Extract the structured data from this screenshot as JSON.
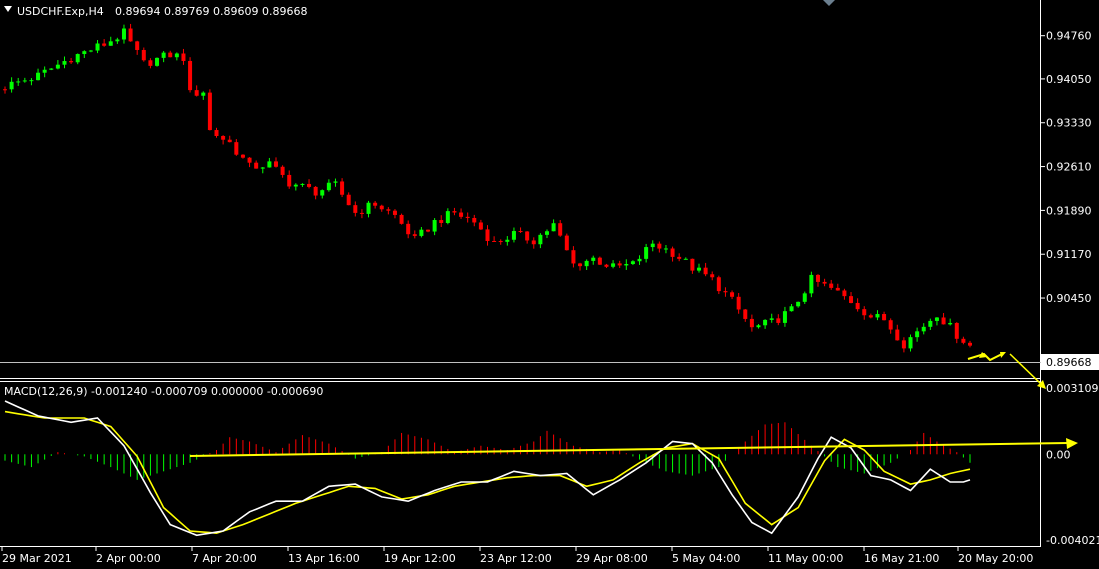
{
  "header": {
    "symbol": "USDCHF.Exp,H4",
    "ohlc": "0.89694 0.89769 0.89609 0.89668"
  },
  "macd_header": "MACD(12,26,9) -0.001240 -0.000709 0.000000 -0.000690",
  "current_price_label": "0.89668",
  "colors": {
    "background": "#000000",
    "bull": "#00ff00",
    "bear": "#ff0000",
    "macd_main": "#ffffff",
    "macd_signal": "#ffff00",
    "arrow": "#ffff00",
    "grid_line": "#ffffff"
  },
  "chart_data": [
    {
      "type": "candlestick",
      "timeframe": "H4",
      "ylim": [
        0.8935,
        0.951
      ],
      "y_ticks": [
        "0.94760",
        "0.94050",
        "0.93330",
        "0.92610",
        "0.91890",
        "0.91170",
        "0.90450"
      ],
      "x_ticks": [
        "29 Mar 2021",
        "2 Apr 00:00",
        "7 Apr 20:00",
        "13 Apr 16:00",
        "19 Apr 12:00",
        "23 Apr 12:00",
        "29 Apr 08:00",
        "5 May 04:00",
        "11 May 00:00",
        "16 May 21:00",
        "20 May 20:00"
      ],
      "close_path": [
        [
          0,
          0.9393
        ],
        [
          5,
          0.941
        ],
        [
          10,
          0.944
        ],
        [
          15,
          0.9462
        ],
        [
          18,
          0.948
        ],
        [
          21,
          0.943
        ],
        [
          25,
          0.9445
        ],
        [
          27,
          0.944
        ],
        [
          28,
          0.938
        ],
        [
          30,
          0.9385
        ],
        [
          31,
          0.932
        ],
        [
          34,
          0.93
        ],
        [
          37,
          0.926
        ],
        [
          40,
          0.9265
        ],
        [
          43,
          0.9235
        ],
        [
          47,
          0.922
        ],
        [
          50,
          0.923
        ],
        [
          53,
          0.9185
        ],
        [
          56,
          0.92
        ],
        [
          59,
          0.918
        ],
        [
          62,
          0.914
        ],
        [
          65,
          0.917
        ],
        [
          68,
          0.9185
        ],
        [
          71,
          0.917
        ],
        [
          74,
          0.9135
        ],
        [
          77,
          0.915
        ],
        [
          80,
          0.914
        ],
        [
          83,
          0.9165
        ],
        [
          86,
          0.91
        ],
        [
          89,
          0.911
        ],
        [
          92,
          0.9095
        ],
        [
          95,
          0.91
        ],
        [
          98,
          0.9135
        ],
        [
          101,
          0.912
        ],
        [
          104,
          0.9095
        ],
        [
          107,
          0.9075
        ],
        [
          110,
          0.904
        ],
        [
          113,
          0.8995
        ],
        [
          116,
          0.9005
        ],
        [
          119,
          0.9025
        ],
        [
          122,
          0.9075
        ],
        [
          125,
          0.906
        ],
        [
          128,
          0.904
        ],
        [
          131,
          0.9015
        ],
        [
          133,
          0.901
        ],
        [
          136,
          0.897
        ],
        [
          138,
          0.899
        ],
        [
          141,
          0.902
        ],
        [
          144,
          0.8985
        ],
        [
          146,
          0.8967
        ]
      ],
      "current_price": 0.89668
    },
    {
      "type": "line",
      "title": "MACD(12,26,9)",
      "values": {
        "main": -0.00124,
        "signal": -0.000709,
        "zero": 0.0,
        "histogram": -0.00069
      },
      "ylim": [
        -0.004021,
        0.003109
      ],
      "y_ticks": [
        "0.003109",
        "0.00",
        "-0.004021"
      ],
      "main_path": [
        [
          0,
          0.0025
        ],
        [
          5,
          0.0018
        ],
        [
          10,
          0.0015
        ],
        [
          14,
          0.0017
        ],
        [
          18,
          0.0004
        ],
        [
          22,
          -0.0018
        ],
        [
          25,
          -0.0033
        ],
        [
          29,
          -0.0038
        ],
        [
          33,
          -0.0036
        ],
        [
          37,
          -0.0027
        ],
        [
          41,
          -0.0022
        ],
        [
          45,
          -0.0022
        ],
        [
          49,
          -0.0015
        ],
        [
          53,
          -0.0014
        ],
        [
          57,
          -0.002
        ],
        [
          61,
          -0.0022
        ],
        [
          65,
          -0.0017
        ],
        [
          69,
          -0.0013
        ],
        [
          73,
          -0.0013
        ],
        [
          77,
          -0.0008
        ],
        [
          81,
          -0.001
        ],
        [
          85,
          -0.0009
        ],
        [
          89,
          -0.0019
        ],
        [
          93,
          -0.0012
        ],
        [
          97,
          -0.0004
        ],
        [
          101,
          0.0006
        ],
        [
          104,
          0.0005
        ],
        [
          107,
          -0.0004
        ],
        [
          110,
          -0.0019
        ],
        [
          113,
          -0.0032
        ],
        [
          116,
          -0.0037
        ],
        [
          120,
          -0.002
        ],
        [
          123,
          -0.0002
        ],
        [
          125,
          0.0008
        ],
        [
          128,
          0.0003
        ],
        [
          131,
          -0.001
        ],
        [
          134,
          -0.0012
        ],
        [
          137,
          -0.0017
        ],
        [
          140,
          -0.0007
        ],
        [
          143,
          -0.0013
        ],
        [
          145,
          -0.0013
        ],
        [
          146,
          -0.0012
        ]
      ],
      "signal_path": [
        [
          0,
          0.002
        ],
        [
          6,
          0.0017
        ],
        [
          12,
          0.0017
        ],
        [
          16,
          0.0013
        ],
        [
          20,
          -0.0001
        ],
        [
          24,
          -0.0025
        ],
        [
          28,
          -0.0036
        ],
        [
          32,
          -0.0037
        ],
        [
          36,
          -0.0033
        ],
        [
          40,
          -0.0028
        ],
        [
          44,
          -0.0023
        ],
        [
          48,
          -0.0019
        ],
        [
          52,
          -0.0015
        ],
        [
          56,
          -0.0016
        ],
        [
          60,
          -0.0021
        ],
        [
          64,
          -0.0019
        ],
        [
          68,
          -0.0015
        ],
        [
          72,
          -0.0013
        ],
        [
          76,
          -0.0011
        ],
        [
          80,
          -0.001
        ],
        [
          84,
          -0.001
        ],
        [
          88,
          -0.0015
        ],
        [
          92,
          -0.0012
        ],
        [
          96,
          -0.0004
        ],
        [
          100,
          0.0003
        ],
        [
          104,
          0.0005
        ],
        [
          108,
          -0.0002
        ],
        [
          112,
          -0.0023
        ],
        [
          116,
          -0.0033
        ],
        [
          120,
          -0.0025
        ],
        [
          124,
          -0.0003
        ],
        [
          127,
          0.0007
        ],
        [
          130,
          0.0002
        ],
        [
          133,
          -0.0008
        ],
        [
          137,
          -0.0014
        ],
        [
          140,
          -0.0012
        ],
        [
          143,
          -0.0009
        ],
        [
          146,
          -0.0007
        ]
      ],
      "histogram_path": [
        [
          0,
          -0.0003
        ],
        [
          4,
          -0.0006
        ],
        [
          8,
          0.0001
        ],
        [
          12,
          -0.0001
        ],
        [
          16,
          -0.0006
        ],
        [
          20,
          -0.0012
        ],
        [
          24,
          -0.0008
        ],
        [
          28,
          -0.0004
        ],
        [
          32,
          0.0002
        ],
        [
          34,
          0.0008
        ],
        [
          37,
          0.0006
        ],
        [
          41,
          0.0001
        ],
        [
          45,
          0.0009
        ],
        [
          49,
          0.0005
        ],
        [
          53,
          -0.0002
        ],
        [
          57,
          0.0001
        ],
        [
          60,
          0.001
        ],
        [
          64,
          0.0007
        ],
        [
          68,
          0.0001
        ],
        [
          72,
          0.0004
        ],
        [
          76,
          0.0002
        ],
        [
          80,
          0.0006
        ],
        [
          82,
          0.0011
        ],
        [
          86,
          0.0004
        ],
        [
          90,
          0.0001
        ],
        [
          93,
          0.0002
        ],
        [
          97,
          -0.0004
        ],
        [
          100,
          -0.0008
        ],
        [
          104,
          -0.001
        ],
        [
          108,
          -0.0006
        ],
        [
          112,
          0.0006
        ],
        [
          115,
          0.0014
        ],
        [
          118,
          0.0015
        ],
        [
          122,
          0.0004
        ],
        [
          126,
          -0.0006
        ],
        [
          130,
          -0.0009
        ],
        [
          134,
          -0.0004
        ],
        [
          137,
          0.0002
        ],
        [
          139,
          0.001
        ],
        [
          141,
          0.0006
        ],
        [
          144,
          0.0001
        ],
        [
          146,
          -0.0004
        ]
      ]
    }
  ]
}
